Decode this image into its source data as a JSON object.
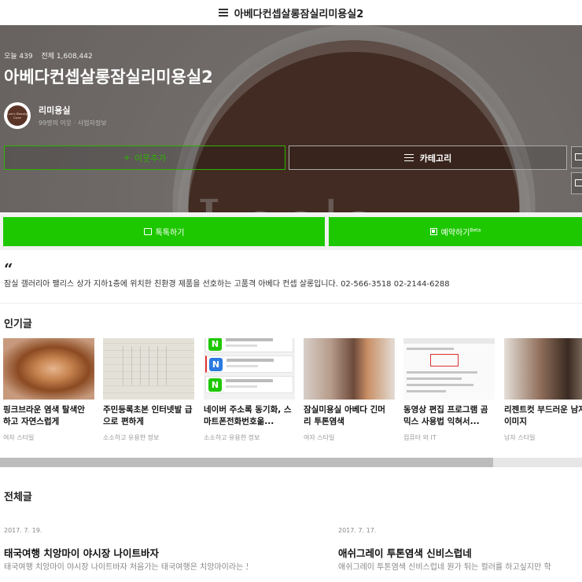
{
  "topbar": {
    "title": "아베다컨셉살롱잠실리미용실2"
  },
  "hero": {
    "stats_today": "오늘 439",
    "stats_total": "전체 1,608,442",
    "title": "아베다컨셉살롱잠실리미용실2",
    "owner_name": "리미용실",
    "owner_sub": "99명의 이웃 · 사업자정보",
    "avatar_text": "Lee's Beauty Care",
    "decor_text": "Lee's",
    "neighbor_label": "이웃추가",
    "category_label": "카테고리"
  },
  "actions": {
    "talk_label": "톡톡하기",
    "book_label": "예약하기",
    "book_badge": "Beta"
  },
  "intro": {
    "text": "잠실 갤러리아 팰리스 상가 지하1층에 위치한 친환경 제품을 선호하는 고품격 아베다 컨셉 살롱입니다. 02-566-3518 02-2144-6288"
  },
  "popular": {
    "heading": "인기글",
    "items": [
      {
        "title": "핑크브라운 염색 탈색안 하고 자연스럽게",
        "category": "여자 스타일"
      },
      {
        "title": "주민등록초본 인터넷발 급으로 편하게",
        "category": "소소하고 유용한 정보"
      },
      {
        "title": "네이버 주소록 동기화, 스마트폰전화번호옮...",
        "category": "소소하고 유용한 정보"
      },
      {
        "title": "잠실미용실 아베다 긴머 리 투톤염색",
        "category": "여자 스타일"
      },
      {
        "title": "동영상 편집 프로그램 곰믹스 사용법 익혀서...",
        "category": "컴퓨터 와 IT"
      },
      {
        "title": "리젠트컷 부드러운 남자 이미지",
        "category": "남자 스타일"
      }
    ]
  },
  "all_posts": {
    "heading": "전체글",
    "items": [
      {
        "date": "2017. 7. 19.",
        "title": "태국여행 치앙마이 야시장 나이트바자",
        "excerpt": "태국여행 치앙마이 야시장 나이트바자 처음가는 태국여행은 치앙마이라는 도시였답"
      },
      {
        "date": "2017. 7. 17.",
        "title": "애쉬그레이 투톤염색 신비스럽네",
        "excerpt": "애쉬그레이 투톤염색 신비스럽네 뭔가 튀는 컬러를 하고싶지만 학"
      }
    ]
  },
  "colors": {
    "naver_green": "#1ec800",
    "neighbor_green": "#2db400"
  }
}
